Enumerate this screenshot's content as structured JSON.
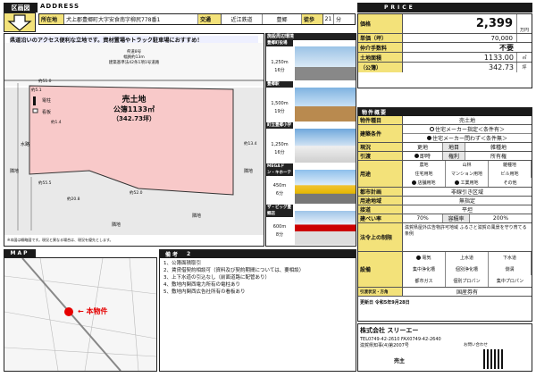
{
  "header": {
    "region_label": "区画図",
    "address_label": "ADDRESS",
    "price_label": "PRICE",
    "location_label": "所在地",
    "location_value": "犬上郡豊郷町大字安食南字柳尻778番1",
    "transport_label": "交通",
    "railway": "近江鉄道",
    "station": "豊郷",
    "walk_label": "徒歩",
    "walk_minutes": "21",
    "walk_unit": "分"
  },
  "price": {
    "price_label": "価格",
    "price_value": "2,399",
    "price_unit": "万円",
    "tsubo_label": "単価（坪）",
    "tsubo_value": "70,000",
    "fee_label": "仲介手数料",
    "fee_value": "不要",
    "area_label": "土地面積",
    "area_sqm": "1133.00",
    "area_unit": "㎡",
    "area_note": "（公簿）",
    "area_tsubo": "342.73",
    "tsubo_unit": "坪"
  },
  "map": {
    "banner": "県道沿いのアクセス便利な立地です。資材置場やトラック駐車場におすすめ！",
    "land_title": "売土地",
    "land_area": "公簿1133㎡",
    "land_tsubo": "（342.73坪）",
    "road_top": "県道8号",
    "road_width": "幅員約13m",
    "road_note": "建築基準法42条1項1号道路",
    "neighbor": "隣地",
    "side_road": "水路",
    "d1": "約51.0",
    "d2": "約52.0",
    "d3": "約13.4",
    "d4": "約20.8",
    "d5": "約55.5",
    "d6": "約5.1",
    "d7": "約1.4",
    "pole": "電柱",
    "sign": "看板",
    "footnote": "※本図は概略図です。現況と異なる場合は、現況を優先とします。",
    "scale": "縮尺約1/50，形状の入りに異なります。"
  },
  "nearby": {
    "title": "施設周辺環境",
    "items": [
      {
        "name": "豊郷町役場",
        "dist": "1,250",
        "unit": "m",
        "walk": "16",
        "wu": "分"
      },
      {
        "name": "豊郷駅",
        "dist": "1,500",
        "unit": "m",
        "walk": "19",
        "wu": "分"
      },
      {
        "name": "町立豊郷小学校",
        "dist": "1,250",
        "unit": "m",
        "walk": "16",
        "wu": "分"
      },
      {
        "name": "MEGAドン・キホーテ豊郷店",
        "dist": "450",
        "unit": "m",
        "walk": "6",
        "wu": "分"
      },
      {
        "name": "ザ・ビッグ豊郷店",
        "dist": "600",
        "unit": "m",
        "walk": "8",
        "wu": "分"
      }
    ]
  },
  "overview": {
    "title": "物件概要",
    "type_label": "物件種目",
    "type_value": "売土地",
    "cond_label": "建築条件",
    "cond_opt1": "住宅メーカー指定＜条件有＞",
    "cond_opt2": "住宅メーカー問わず＜条件無＞",
    "status_label": "現況",
    "status_value": "更地",
    "handover_label": "引渡",
    "handover_value": "即時",
    "owner_label": "権利",
    "owner_value": "所有権",
    "zone_label": "用途",
    "zone_items": [
      "農地",
      "山林",
      "雑種地",
      "宅地",
      "田",
      "畑",
      "住宅用地",
      "マンション用地",
      "ビル用地",
      "店舗用地",
      "工業用地",
      "その他"
    ],
    "rec_label": "都市計画",
    "rec_value": "非線引き区域",
    "yoto_label": "用途地域",
    "yoto_value": "無指定",
    "road_label": "接道",
    "road_value": "平坦",
    "ken_label": "建ぺい率",
    "ken_value": "70%",
    "yoseki_label": "容積率",
    "yoseki_value": "200%",
    "chimoku_label": "地目",
    "chimoku_value": "雑種地",
    "law_label": "法令上の制限",
    "law_value": "滋賀県屋外広告物許可地域 ふるさと滋賀の風景を守り育てる条例",
    "equip_label": "設備",
    "equip": [
      "電気",
      "上水道",
      "下水道",
      "集中浄化槽",
      "個別浄化槽",
      "側溝",
      "都市ガス",
      "個別プロパン",
      "集中プロパン"
    ],
    "transfer_label": "引渡状況・方角",
    "transfer_value": "国産券有"
  },
  "area_map": {
    "label": "MAP",
    "marker": "本物件"
  },
  "remarks": {
    "label": "備考",
    "items": [
      "1、公簿面積取引",
      "2、賃貸借契約相談可（資料及び契約期間については、要相談）",
      "3、上下水道の引込なし（前面道路に配管あり）",
      "4、敷地内関西電力所有の電柱あり",
      "5、敷地内関西広告社所有の看板あり"
    ]
  },
  "footer": {
    "company": "株式会社 スリーエー",
    "tel": "TEL0749-42-2610 FAX0749-42-2640",
    "updated": "更新日 令和5年9月28日",
    "seller": "売主",
    "license": "滋賀県知事(4)第2007号",
    "contact": "お問い合わせ"
  }
}
